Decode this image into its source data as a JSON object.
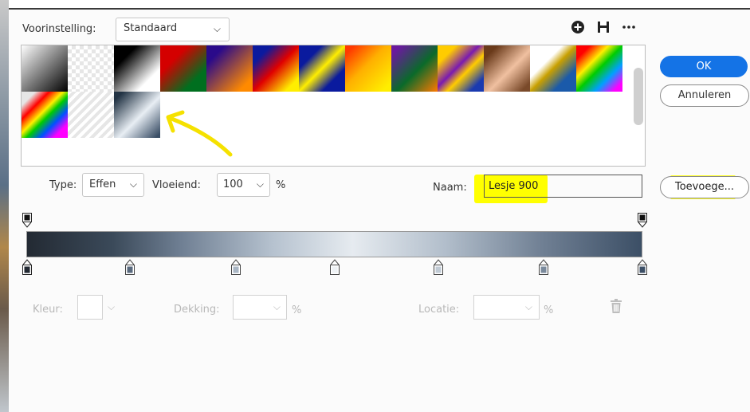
{
  "preset": {
    "label": "Voorinstelling:",
    "value": "Standaard"
  },
  "toolbar": {
    "add_icon": "plus-circle-icon",
    "save_icon": "save-icon",
    "more_icon": "more-icon"
  },
  "buttons": {
    "ok": "OK",
    "cancel": "Annuleren",
    "add": "Toevoege..."
  },
  "type": {
    "label": "Type:",
    "value": "Effen"
  },
  "smoothness": {
    "label": "Vloeiend:",
    "value": "100",
    "unit": "%"
  },
  "name": {
    "label": "Naam:",
    "value": "Lesje 900"
  },
  "stops": {
    "color_label": "Kleur:",
    "opacity_label": "Dekking:",
    "opacity_unit": "%",
    "location_label": "Locatie:",
    "location_unit": "%"
  },
  "colors": {
    "accent": "#1473e6",
    "highlight": "#ffff00"
  },
  "swatches": [
    "linear-gradient(135deg,#ffffff 0%,#000000 100%)",
    "repeating-conic-gradient(#e6e6e6 0 25%,#ffffff 0 50%) 0 0/10px 10px",
    "linear-gradient(135deg,#000000 25%,#ffffff 75%)",
    "linear-gradient(135deg,#d40000 30%,#006f1f 75%)",
    "linear-gradient(135deg,#2a0a8a 20%,#ff8a00 85%)",
    "linear-gradient(135deg,#0b1a9e 20%,#e00000 50%,#ffee00 85%)",
    "linear-gradient(135deg,#0a1a9e 25%,#ffee00 50%,#0a1a9e 75%)",
    "linear-gradient(135deg,#ff3a00 10%,#ffb000 45%,#ffee00 90%)",
    "linear-gradient(135deg,#6a1a9e 10%,#0a6a2a 55%,#ff7a00 100%)",
    "linear-gradient(135deg,#ffcc00 20%,#7a1ab0 45%,#ffcc00 60%,#1a3ab0 85%)",
    "linear-gradient(135deg,#6a3a1a 15%,#f0c0a0 55%,#7a4a2a 90%)",
    "linear-gradient(135deg,#ffffff 35%,#c9a000 50%,#1a5aaa 75%)",
    "linear-gradient(135deg,#ff0000 15%,#ffee00 35%,#00cc00 50%,#00a0ff 70%,#ff00ff 90%)",
    "linear-gradient(135deg,#e6e6e6 15%,#ff0000 30%,#ffee00 45%,#00cc00 55%,#0050ff 70%,#ff00ff 85%)",
    "repeating-linear-gradient(135deg,#ffffff 0 4px,#e6e6e6 4px 8px)",
    "linear-gradient(135deg,#223344 10%,#e8eef4 55%,#3a4e66 95%)"
  ]
}
